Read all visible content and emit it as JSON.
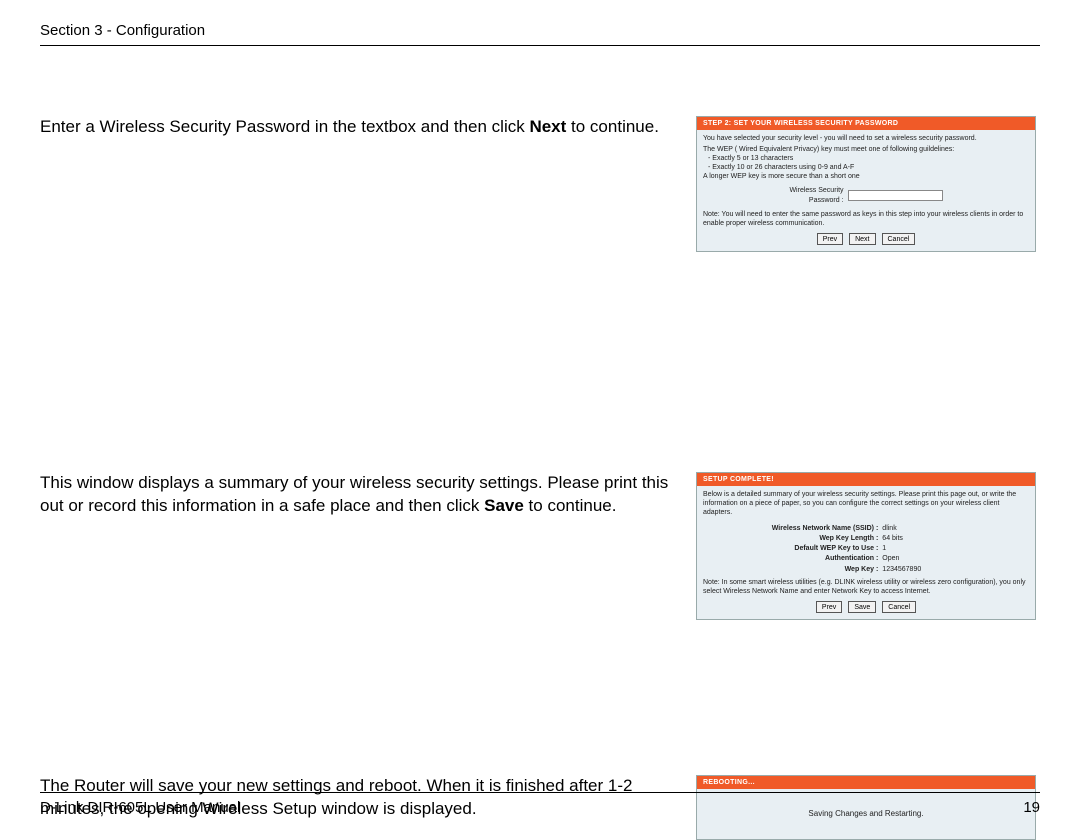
{
  "header": {
    "section": "Section 3 - Configuration"
  },
  "footer": {
    "manual": "D-Link DIR-605L User Manual",
    "page": "19"
  },
  "row1": {
    "instruction_pre": "Enter a Wireless Security Password in the textbox and then click ",
    "instruction_bold": "Next",
    "instruction_post": " to continue.",
    "panel_title": "STEP 2: SET YOUR WIRELESS SECURITY PASSWORD",
    "line1": "You have selected your security level - you will need to set a wireless security password.",
    "line2": "The WEP ( Wired Equivalent Privacy) key must meet one of following guildelines:",
    "bullet1": "- Exactly 5 or 13 characters",
    "bullet2": "- Exactly 10 or 26 characters using 0-9 and A-F",
    "line3": "A longer WEP key is more secure than a short one",
    "field_label": "Wireless Security\nPassword :",
    "note": "Note: You will need to enter the same password as keys in this step into your wireless clients in order to enable proper wireless communication.",
    "btn_prev": "Prev",
    "btn_next": "Next",
    "btn_cancel": "Cancel"
  },
  "row2": {
    "instruction_pre": "This window displays a summary of your wireless security settings. Please print this out or record this information in a safe place and then click ",
    "instruction_bold": "Save",
    "instruction_post": " to continue.",
    "panel_title": "SETUP COMPLETE!",
    "intro": "Below is a detailed summary of your wireless security settings. Please print this page out, or write the information on a piece of paper, so you can configure the correct settings on your wireless client adapters.",
    "kv": [
      {
        "k": "Wireless Network Name (SSID) :",
        "v": "dlink"
      },
      {
        "k": "Wep Key Length :",
        "v": "64 bits"
      },
      {
        "k": "Default WEP Key to Use :",
        "v": "1"
      },
      {
        "k": "Authentication :",
        "v": "Open"
      },
      {
        "k": "Wep Key :",
        "v": "1234567890"
      }
    ],
    "note": "Note: In some smart wireless utilities (e.g. DLINK wireless utility or wireless zero configuration), you only select Wireless Network Name and enter Network Key to access Internet.",
    "btn_prev": "Prev",
    "btn_save": "Save",
    "btn_cancel": "Cancel"
  },
  "row3": {
    "instruction": "The Router will save your new settings and reboot. When it is finished after 1-2 minutes, the opening Wireless Setup window is displayed.",
    "panel_title": "REBOOTING...",
    "msg": "Saving Changes and Restarting."
  }
}
